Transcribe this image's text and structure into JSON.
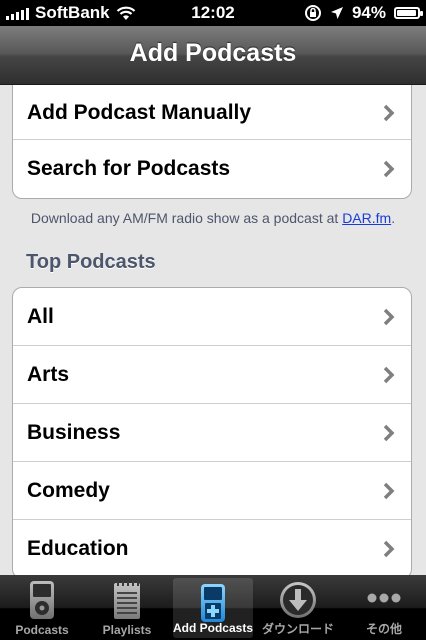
{
  "status_bar": {
    "carrier": "SoftBank",
    "time": "12:02",
    "battery_percent": "94%",
    "battery_level": 0.94
  },
  "nav": {
    "title": "Add Podcasts"
  },
  "top_group": {
    "items": [
      {
        "label": "Add Podcast Manually"
      },
      {
        "label": "Search for Podcasts"
      }
    ]
  },
  "note": {
    "text": "Download any AM/FM radio show as a podcast at ",
    "link": "DAR.fm",
    "suffix": "."
  },
  "section": {
    "title": "Top Podcasts"
  },
  "categories": {
    "items": [
      {
        "label": "All"
      },
      {
        "label": "Arts"
      },
      {
        "label": "Business"
      },
      {
        "label": "Comedy"
      },
      {
        "label": "Education"
      }
    ]
  },
  "tabbar": {
    "tabs": [
      {
        "label": "Podcasts",
        "icon": "ipod-icon"
      },
      {
        "label": "Playlists",
        "icon": "notepad-icon"
      },
      {
        "label": "Add Podcasts",
        "icon": "add-podcast-icon"
      },
      {
        "label": "ダウンロード",
        "icon": "download-icon"
      },
      {
        "label": "その他",
        "icon": "more-icon"
      }
    ],
    "selected_index": 2
  }
}
